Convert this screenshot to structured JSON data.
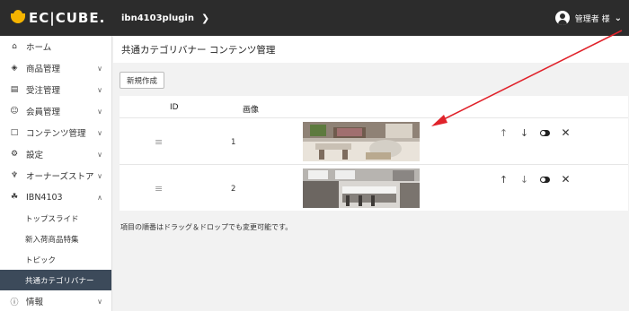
{
  "header": {
    "logo": "EC|CUBE.",
    "breadcrumb": "ibn4103plugin",
    "user": "管理者 様"
  },
  "sidebar": {
    "items": [
      {
        "icon": "home-icon",
        "label": "ホーム",
        "has_chevron": false
      },
      {
        "icon": "cube-icon",
        "label": "商品管理",
        "has_chevron": true
      },
      {
        "icon": "cart-icon",
        "label": "受注管理",
        "has_chevron": true
      },
      {
        "icon": "users-icon",
        "label": "会員管理",
        "has_chevron": true
      },
      {
        "icon": "document-icon",
        "label": "コンテンツ管理",
        "has_chevron": true
      },
      {
        "icon": "gear-icon",
        "label": "設定",
        "has_chevron": true
      },
      {
        "icon": "plug-icon",
        "label": "オーナーズストア",
        "has_chevron": true
      },
      {
        "icon": "puzzle-icon",
        "label": "IBN4103",
        "has_chevron": true
      }
    ],
    "subitems": [
      "トップスライド",
      "新入荷商品特集",
      "トピック",
      "共通カテゴリバナー"
    ],
    "active_subitem": "共通カテゴリバナー",
    "info": "情報"
  },
  "main": {
    "title": "共通カテゴリバナー コンテンツ管理",
    "new_button": "新規作成",
    "columns": {
      "id": "ID",
      "image": "画像"
    },
    "rows": [
      {
        "id": "1",
        "image": "banner-living-room"
      },
      {
        "id": "2",
        "image": "banner-kitchen"
      }
    ],
    "note": "項目の順番はドラッグ＆ドロップでも変更可能です。"
  },
  "colors": {
    "header_bg": "#2c2c2c",
    "logo_accent": "#f5b400",
    "active_bg": "#3c4a5a",
    "annotation_arrow": "#e0232b"
  }
}
